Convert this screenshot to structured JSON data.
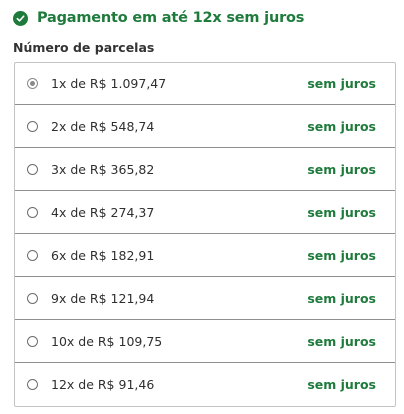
{
  "promo": {
    "icon": "check-circle-icon",
    "text": "Pagamento em até 12x sem juros",
    "color": "#1e7b3c"
  },
  "installments": {
    "label": "Número de parcelas",
    "selected_index": 0,
    "options": [
      {
        "label": "1x de R$ 1.097,47",
        "tag": "sem juros"
      },
      {
        "label": "2x de R$ 548,74",
        "tag": "sem juros"
      },
      {
        "label": "3x de R$ 365,82",
        "tag": "sem juros"
      },
      {
        "label": "4x de R$ 274,37",
        "tag": "sem juros"
      },
      {
        "label": "6x de R$ 182,91",
        "tag": "sem juros"
      },
      {
        "label": "9x de R$ 121,94",
        "tag": "sem juros"
      },
      {
        "label": "10x de R$ 109,75",
        "tag": "sem juros"
      },
      {
        "label": "12x de R$ 91,46",
        "tag": "sem juros"
      }
    ]
  }
}
